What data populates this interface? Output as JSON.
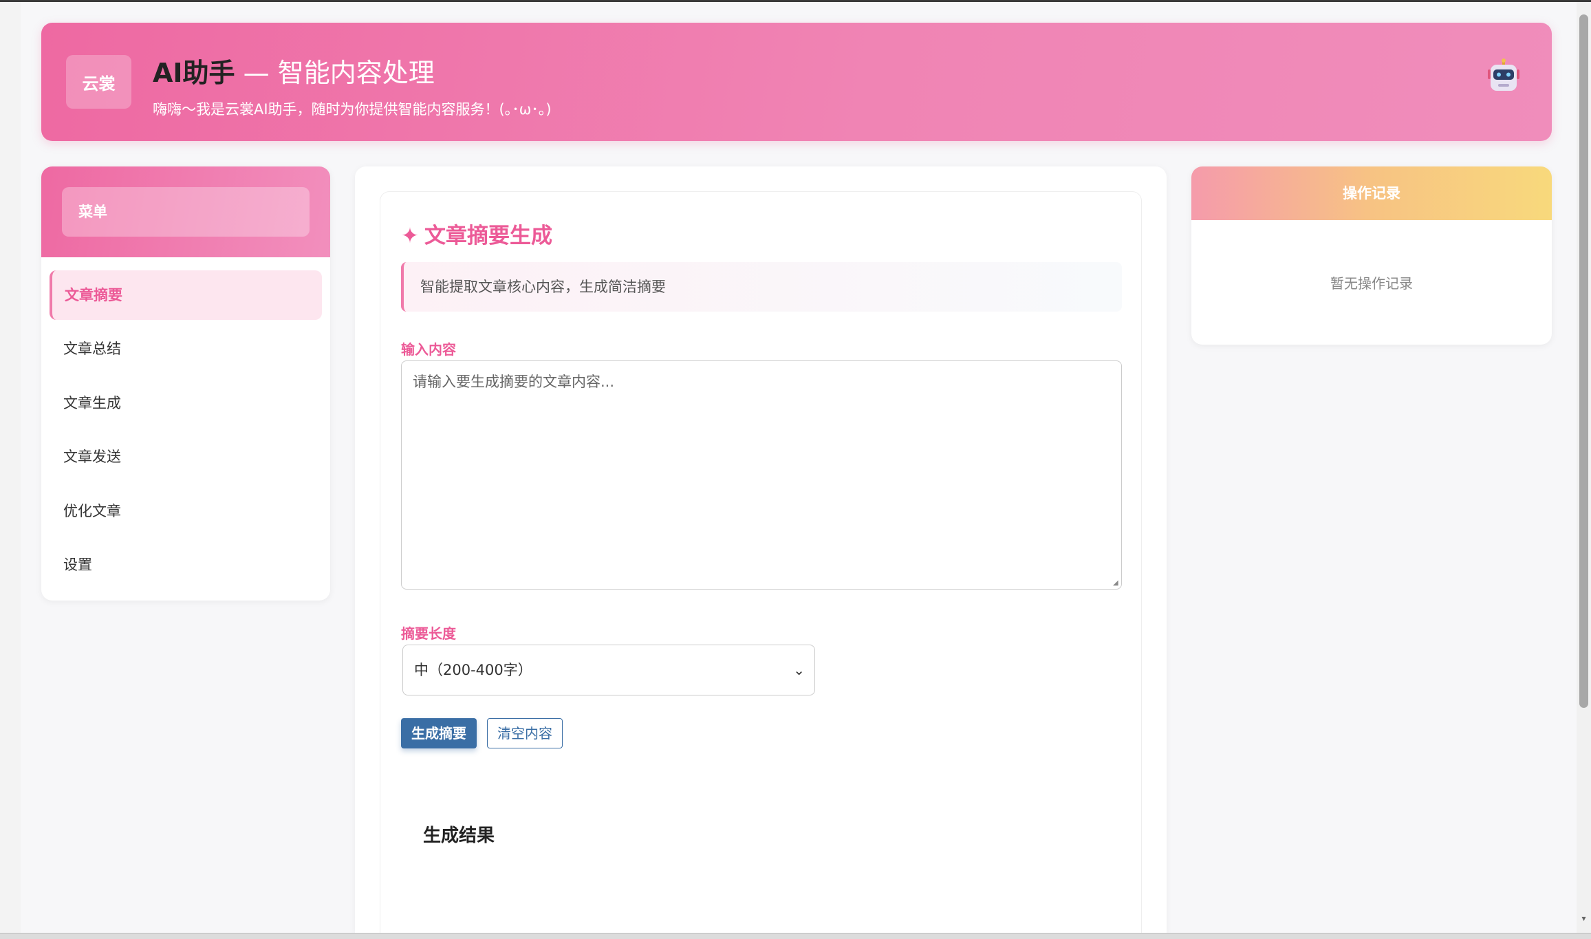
{
  "header": {
    "logo_text": "云裳",
    "title_strong": "AI助手",
    "title_rest": " — 智能内容处理",
    "subtitle": "嗨嗨～我是云裳AI助手，随时为你提供智能内容服务！(｡･ω･｡)",
    "robot_icon": "robot-icon"
  },
  "sidebar": {
    "header_label": "菜单",
    "items": [
      {
        "label": "文章摘要",
        "active": true
      },
      {
        "label": "文章总结",
        "active": false
      },
      {
        "label": "文章生成",
        "active": false
      },
      {
        "label": "文章发送",
        "active": false
      },
      {
        "label": "优化文章",
        "active": false
      },
      {
        "label": "设置",
        "active": false
      }
    ]
  },
  "main": {
    "title": "文章摘要生成",
    "title_icon": "✦",
    "description": "智能提取文章核心内容，生成简洁摘要",
    "input_label": "输入内容",
    "input_placeholder": "请输入要生成摘要的文章内容...",
    "input_value": "",
    "length_label": "摘要长度",
    "length_selected": "中（200-400字）",
    "generate_button": "生成摘要",
    "clear_button": "清空内容",
    "result_title": "生成结果"
  },
  "log": {
    "title": "操作记录",
    "empty_text": "暂无操作记录"
  },
  "colors": {
    "primary_pink": "#ee69a2",
    "accent_blue": "#3a6ea5",
    "log_gradient_end": "#f8d97c"
  }
}
